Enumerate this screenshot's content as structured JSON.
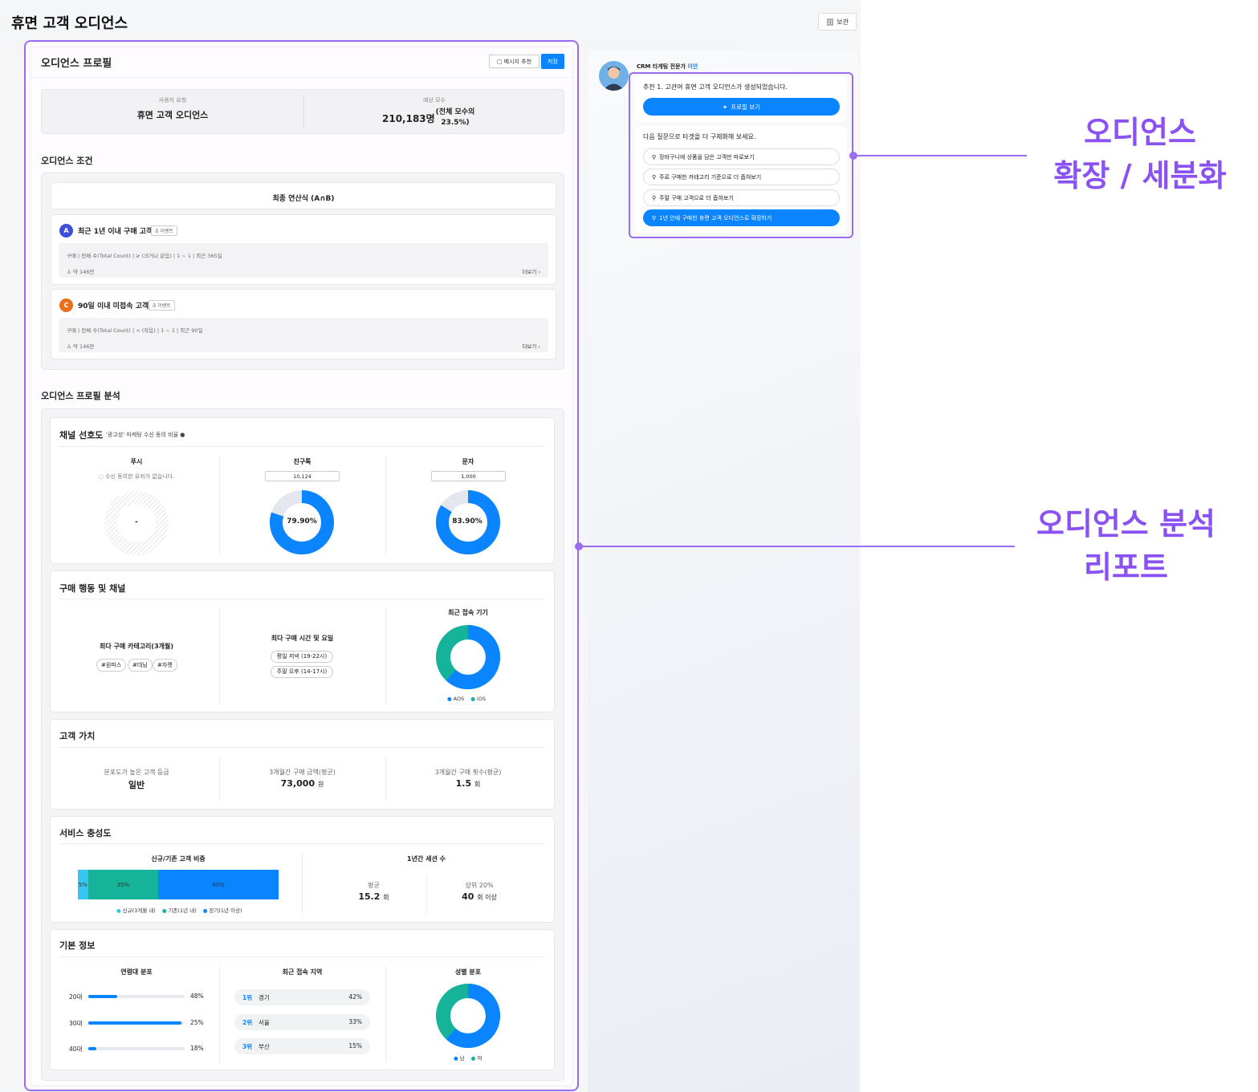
{
  "page": {
    "title": "휴면 고객 오디언스",
    "store_label": "보관"
  },
  "profile": {
    "title": "오디언스 프로필",
    "message_btn": "메시지 추천",
    "save_btn": "저장",
    "summary": {
      "request_label": "사용자 요청",
      "request_value": "휴면 고객 오디언스",
      "estimate_label": "예상 모수",
      "estimate_value": "210,183명",
      "estimate_ratio_1": "(전체 모수의",
      "estimate_ratio_2": "23.5%)"
    }
  },
  "conditions": {
    "title": "오디언스 조건",
    "formula": "최종 연산식 (A∩B)",
    "items": [
      {
        "badge": "A",
        "name": "최근 1년 이내 구매 고객",
        "tag": "이벤트",
        "rule": "구매 | 전체 수(Total Count) | ≥ (크거나 같음) | 1 ~ 1 | 최근 365일",
        "count": "약 146만",
        "more": "더보기",
        "color": "#3b4fd8"
      },
      {
        "badge": "C",
        "name": "90일 이내 미접속 고객",
        "tag": "이벤트",
        "rule": "구매 | 전체 수(Total Count) | < (작음) | 1 ~ 1 | 최근 90일",
        "count": "약 146만",
        "more": "더보기",
        "color": "#e8701a"
      }
    ]
  },
  "analysis": {
    "title": "오디언스 프로필 분석",
    "channel": {
      "title": "채널 선호도",
      "subtitle": "'광고성' 마케팅 수신 동의 비율",
      "push": {
        "title": "푸시",
        "note": "수신 동의한 유저가 없습니다.",
        "center": "-"
      },
      "kakao": {
        "title": "친구톡",
        "count": "10,124",
        "pct": "79.90%",
        "ratio": 0.799
      },
      "sms": {
        "title": "문자",
        "count": "1,000",
        "pct": "83.90%",
        "ratio": 0.839
      }
    },
    "behavior": {
      "title": "구매 행동 및 채널",
      "category_title": "최다 구매 카테고리(3개월)",
      "categories": [
        "#원피스",
        "#데님",
        "#자켓"
      ],
      "time_title": "최다 구매 시간 및 요일",
      "times": [
        "평일 저녁 (19-22시)",
        "주말 오후 (14-17시)"
      ],
      "device_title": "최근 접속 기기",
      "device_legend": [
        "AOS",
        "iOS"
      ],
      "device_aos_ratio": 0.62
    },
    "value": {
      "title": "고객 가치",
      "metrics": [
        {
          "label": "분포도가 높은 고객 등급",
          "value": "일반",
          "unit": ""
        },
        {
          "label": "3개월간 구매 금액(평균)",
          "value": "73,000",
          "unit": "원"
        },
        {
          "label": "3개월간 구매 횟수(평균)",
          "value": "1.5",
          "unit": "회"
        }
      ]
    },
    "loyalty": {
      "title": "서비스 충성도",
      "ratio_title": "신규/기존 고객 비중",
      "segments": [
        {
          "label": "5%",
          "value": 5,
          "color": "#36c5f0"
        },
        {
          "label": "35%",
          "value": 35,
          "color": "#14b39a"
        },
        {
          "label": "60%",
          "value": 60,
          "color": "#0a84ff"
        }
      ],
      "legend": [
        "신규(3개월 내)",
        "기존(1년 내)",
        "장기(1년 이상)"
      ],
      "session_title": "1년간 세션 수",
      "avg_label": "평균",
      "avg_value": "15.2",
      "avg_unit": "회",
      "top_label": "상위 20%",
      "top_value": "40",
      "top_unit": "회 이상"
    },
    "basic": {
      "title": "기본 정보",
      "age_title": "연령대 분포",
      "ages": [
        {
          "label": "20대",
          "pct": "48%",
          "ratio": 0.3
        },
        {
          "label": "30대",
          "pct": "25%",
          "ratio": 0.97
        },
        {
          "label": "40대",
          "pct": "18%",
          "ratio": 0.08
        }
      ],
      "region_title": "최근 접속 지역",
      "regions": [
        {
          "rank": "1위",
          "name": "경기",
          "pct": "42%"
        },
        {
          "rank": "2위",
          "name": "서울",
          "pct": "33%"
        },
        {
          "rank": "3위",
          "name": "부산",
          "pct": "15%"
        }
      ],
      "gender_title": "성별 분포",
      "gender_legend": [
        "남",
        "여"
      ],
      "male_ratio": 0.62
    }
  },
  "assistant": {
    "name": "CRM 타게팅 전문가",
    "name_highlight": "이안",
    "message1": "추천 1. 고관여 휴면 고객 오디언스가 생성되었습니다.",
    "profile_btn": "프로필 보기",
    "message2": "다음 질문으로 타겟을 더 구체화해 보세요.",
    "suggestions": [
      "장바구니에 상품을 담은 고객만 따로보기",
      "주로 구매한 카테고리 기준으로 더 좁혀보기",
      "주말 구매 고객으로 더 좁혀보기",
      "1년 안에 구매한 휴면 고객 오디언스로 확장하기"
    ]
  },
  "annotations": {
    "top_line1": "오디언스",
    "top_line2": "확장 / 세분화",
    "bottom_line1": "오디언스 분석",
    "bottom_line2": "리포트"
  },
  "colors": {
    "accent": "#0a84ff",
    "teal": "#14b39a",
    "annotation": "#9b6cf0"
  }
}
